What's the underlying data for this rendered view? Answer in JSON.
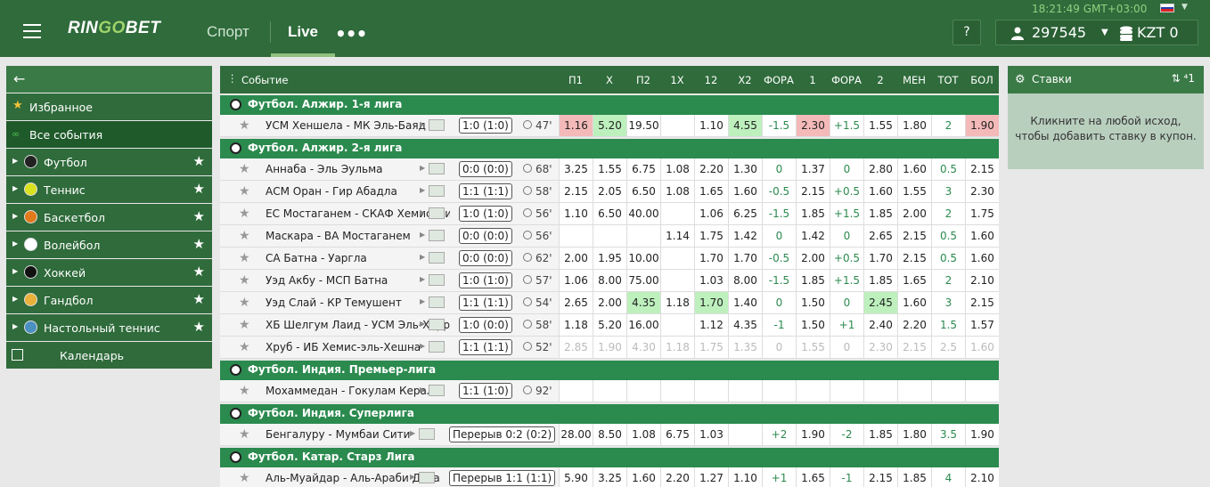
{
  "header": {
    "logo_a": "RIN",
    "logo_b": "GO",
    "logo_c": "BET",
    "nav_sport": "Спорт",
    "nav_live": "Live",
    "more": "•••",
    "clock": "18:21:49 GMT+03:00",
    "help": "?",
    "account_id": "297545",
    "currency": "KZT 0"
  },
  "sidebar": {
    "back_arrow": "←",
    "favorites": "Избранное",
    "all_events": "Все события",
    "calendar": "Календарь",
    "sports": [
      {
        "label": "Футбол",
        "icon": "soccer-ball-icon"
      },
      {
        "label": "Теннис",
        "icon": "tennis-ball-icon"
      },
      {
        "label": "Баскетбол",
        "icon": "basketball-icon"
      },
      {
        "label": "Волейбол",
        "icon": "volleyball-icon"
      },
      {
        "label": "Хоккей",
        "icon": "hockey-puck-icon"
      },
      {
        "label": "Гандбол",
        "icon": "handball-icon"
      },
      {
        "label": "Настольный теннис",
        "icon": "table-tennis-icon"
      }
    ]
  },
  "table": {
    "event_header": "Событие",
    "columns": [
      "П1",
      "Х",
      "П2",
      "1Х",
      "12",
      "Х2",
      "ФОРА",
      "1",
      "ФОРА",
      "2",
      "МЕН",
      "ТОТ",
      "БОЛ"
    ],
    "groups": [
      {
        "league": "Футбол. Алжир. 1-я лига",
        "rows": [
          {
            "name": "УСМ Хеншела - МК Эль-Баяд",
            "score": "1:0 (1:0)",
            "min": "47'",
            "odds": [
              "1.16",
              "5.20",
              "19.50",
              "",
              "1.10",
              "4.55",
              "-1.5",
              "2.30",
              "+1.5",
              "1.55",
              "1.80",
              "2",
              "1.90"
            ],
            "hl": {
              "0": "red",
              "1": "grn",
              "5": "grn",
              "7": "red",
              "12": "red"
            }
          }
        ]
      },
      {
        "league": "Футбол. Алжир. 2-я лига",
        "rows": [
          {
            "name": "Аннаба - Эль Эульма",
            "score": "0:0 (0:0)",
            "min": "68'",
            "odds": [
              "3.25",
              "1.55",
              "6.75",
              "1.08",
              "2.20",
              "1.30",
              "0",
              "1.37",
              "0",
              "2.80",
              "1.60",
              "0.5",
              "2.15"
            ],
            "hl": {}
          },
          {
            "name": "АСМ Оран - Гир Абадла",
            "score": "1:1 (1:1)",
            "min": "58'",
            "odds": [
              "2.15",
              "2.05",
              "6.50",
              "1.08",
              "1.65",
              "1.60",
              "-0.5",
              "2.15",
              "+0.5",
              "1.60",
              "1.55",
              "3",
              "2.30"
            ],
            "hl": {}
          },
          {
            "name": "ЕС Мостаганем - СКАФ Хемис-Милі",
            "score": "1:0 (1:0)",
            "min": "56'",
            "odds": [
              "1.10",
              "6.50",
              "40.00",
              "",
              "1.06",
              "6.25",
              "-1.5",
              "1.85",
              "+1.5",
              "1.85",
              "2.00",
              "2",
              "1.75"
            ],
            "hl": {}
          },
          {
            "name": "Маскара - ВА Мостаганем",
            "score": "0:0 (0:0)",
            "min": "56'",
            "odds": [
              "",
              "",
              "",
              "1.14",
              "1.75",
              "1.42",
              "0",
              "1.42",
              "0",
              "2.65",
              "2.15",
              "0.5",
              "1.60"
            ],
            "hl": {}
          },
          {
            "name": "СА Батна - Уаргла",
            "score": "0:0 (0:0)",
            "min": "62'",
            "odds": [
              "2.00",
              "1.95",
              "10.00",
              "",
              "1.70",
              "1.70",
              "-0.5",
              "2.00",
              "+0.5",
              "1.70",
              "2.15",
              "0.5",
              "1.60"
            ],
            "hl": {}
          },
          {
            "name": "Уэд Акбу - МСП Батна",
            "score": "1:0 (1:0)",
            "min": "57'",
            "odds": [
              "1.06",
              "8.00",
              "75.00",
              "",
              "1.03",
              "8.00",
              "-1.5",
              "1.85",
              "+1.5",
              "1.85",
              "1.65",
              "2",
              "2.10"
            ],
            "hl": {}
          },
          {
            "name": "Уэд Слай - КР Темушент",
            "score": "1:1 (1:1)",
            "min": "54'",
            "odds": [
              "2.65",
              "2.00",
              "4.35",
              "1.18",
              "1.70",
              "1.40",
              "0",
              "1.50",
              "0",
              "2.45",
              "1.60",
              "3",
              "2.15"
            ],
            "hl": {
              "2": "grn",
              "4": "grn",
              "9": "grn"
            }
          },
          {
            "name": "ХБ Шелгум Лаид - УСМ Эль-Харрас",
            "score": "1:0 (0:0)",
            "min": "58'",
            "odds": [
              "1.18",
              "5.20",
              "16.00",
              "",
              "1.12",
              "4.35",
              "-1",
              "1.50",
              "+1",
              "2.40",
              "2.20",
              "1.5",
              "1.57"
            ],
            "hl": {}
          },
          {
            "name": "Хруб - ИБ Хемис-эль-Хешна",
            "score": "1:1 (1:1)",
            "min": "52'",
            "odds": [
              "2.85",
              "1.90",
              "4.30",
              "1.18",
              "1.75",
              "1.35",
              "0",
              "1.55",
              "0",
              "2.30",
              "2.15",
              "2.5",
              "1.60"
            ],
            "hl": {},
            "faded": true
          }
        ]
      },
      {
        "league": "Футбол. Индия. Премьер-лига",
        "rows": [
          {
            "name": "Мохаммедан - Гокулам Керала",
            "score": "1:1 (1:0)",
            "min": "92'",
            "odds": [
              "",
              "",
              "",
              "",
              "",
              "",
              "",
              "",
              "",
              "",
              "",
              "",
              ""
            ],
            "hl": {}
          }
        ]
      },
      {
        "league": "Футбол. Индия. Суперлига",
        "rows": [
          {
            "name": "Бенгалуру - Мумбаи Сити",
            "score": "Перерыв 0:2 (0:2)",
            "min": "",
            "odds": [
              "28.00",
              "8.50",
              "1.08",
              "6.75",
              "1.03",
              "",
              "+2",
              "1.90",
              "-2",
              "1.85",
              "1.80",
              "3.5",
              "1.90"
            ],
            "hl": {}
          }
        ]
      },
      {
        "league": "Футбол. Катар. Старз Лига",
        "rows": [
          {
            "name": "Аль-Муайдар - Аль-Араби Доха",
            "score": "Перерыв 1:1 (1:1)",
            "min": "",
            "odds": [
              "5.90",
              "3.25",
              "1.60",
              "2.20",
              "1.27",
              "1.10",
              "+1",
              "1.65",
              "-1",
              "2.15",
              "1.85",
              "4",
              "2.10"
            ],
            "hl": {}
          }
        ]
      }
    ]
  },
  "coupon": {
    "title": "Ставки",
    "arrows": "⇅ ⁴1",
    "message": "Кликните на любой исход, чтобы добавить ставку в купон."
  }
}
